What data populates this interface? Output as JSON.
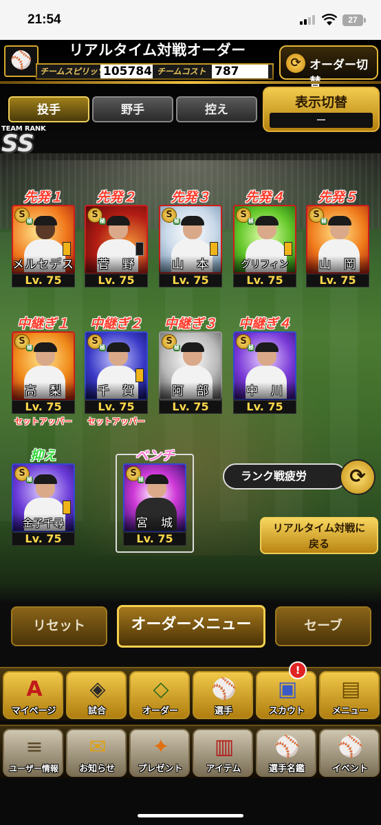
{
  "status_bar": {
    "time": "21:54",
    "battery": "27"
  },
  "header": {
    "logo_glyph": "⚾",
    "title": "リアルタイム対戦オーダー",
    "team_spirits_label": "チームスピリッツ",
    "team_spirits_value": "105784",
    "team_cost_label": "チームコスト",
    "team_cost_value": "787",
    "order_switch_label": "オーダー切替"
  },
  "tabs": [
    {
      "label": "投手",
      "active": true
    },
    {
      "label": "野手",
      "active": false
    },
    {
      "label": "控え",
      "active": false
    }
  ],
  "display_switch": {
    "label": "表示切替",
    "value": "ー"
  },
  "team_rank": {
    "label": "TEAM RANK",
    "value": "SS"
  },
  "starters": [
    {
      "role": "先発１",
      "name": "メルセデス",
      "level": "Lv. 75"
    },
    {
      "role": "先発２",
      "name": "菅　野",
      "level": "Lv. 75"
    },
    {
      "role": "先発３",
      "name": "山　本",
      "level": "Lv. 75"
    },
    {
      "role": "先発４",
      "name": "グリフィン",
      "level": "Lv. 75"
    },
    {
      "role": "先発５",
      "name": "山　岡",
      "level": "Lv. 75"
    }
  ],
  "relievers": [
    {
      "role": "中継ぎ１",
      "name": "高　梨",
      "level": "Lv. 75",
      "tag": "セットアッパー"
    },
    {
      "role": "中継ぎ２",
      "name": "千　賀",
      "level": "Lv. 75",
      "tag": "セットアッパー"
    },
    {
      "role": "中継ぎ３",
      "name": "阿　部",
      "level": "Lv. 75",
      "tag": ""
    },
    {
      "role": "中継ぎ４",
      "name": "中　川",
      "level": "Lv. 75",
      "tag": ""
    }
  ],
  "closer": {
    "role": "抑え",
    "name": "金子千尋",
    "level": "Lv. 75"
  },
  "bench": {
    "role": "ベンチ",
    "name": "宮　城",
    "level": "Lv. 75"
  },
  "rank_fatigue": {
    "label": "ランク戦疲労"
  },
  "back_button": {
    "line1": "リアルタイム対戦に",
    "line2": "戻る"
  },
  "actions": {
    "reset": "リセット",
    "order_menu": "オーダーメニュー",
    "save": "セーブ"
  },
  "nav_row1": [
    {
      "label": "マイページ",
      "icon": "A"
    },
    {
      "label": "試合",
      "icon": "◈"
    },
    {
      "label": "オーダー",
      "icon": "◇"
    },
    {
      "label": "選手",
      "icon": "⚾"
    },
    {
      "label": "スカウト",
      "icon": "▣"
    },
    {
      "label": "メニュー",
      "icon": "▤"
    }
  ],
  "nav_row2": [
    {
      "label": "ユーザー情報",
      "icon": "≡"
    },
    {
      "label": "お知らせ",
      "icon": "✉"
    },
    {
      "label": "プレゼント",
      "icon": "✦"
    },
    {
      "label": "アイテム",
      "icon": "▥"
    },
    {
      "label": "選手名鑑",
      "icon": "⚾"
    },
    {
      "label": "イベント",
      "icon": "⚾"
    }
  ],
  "scout_badge": "!",
  "colors": {
    "gold": "#f0c040",
    "starter_role": "#ff3b2b",
    "level_text": "#ffd94a"
  }
}
